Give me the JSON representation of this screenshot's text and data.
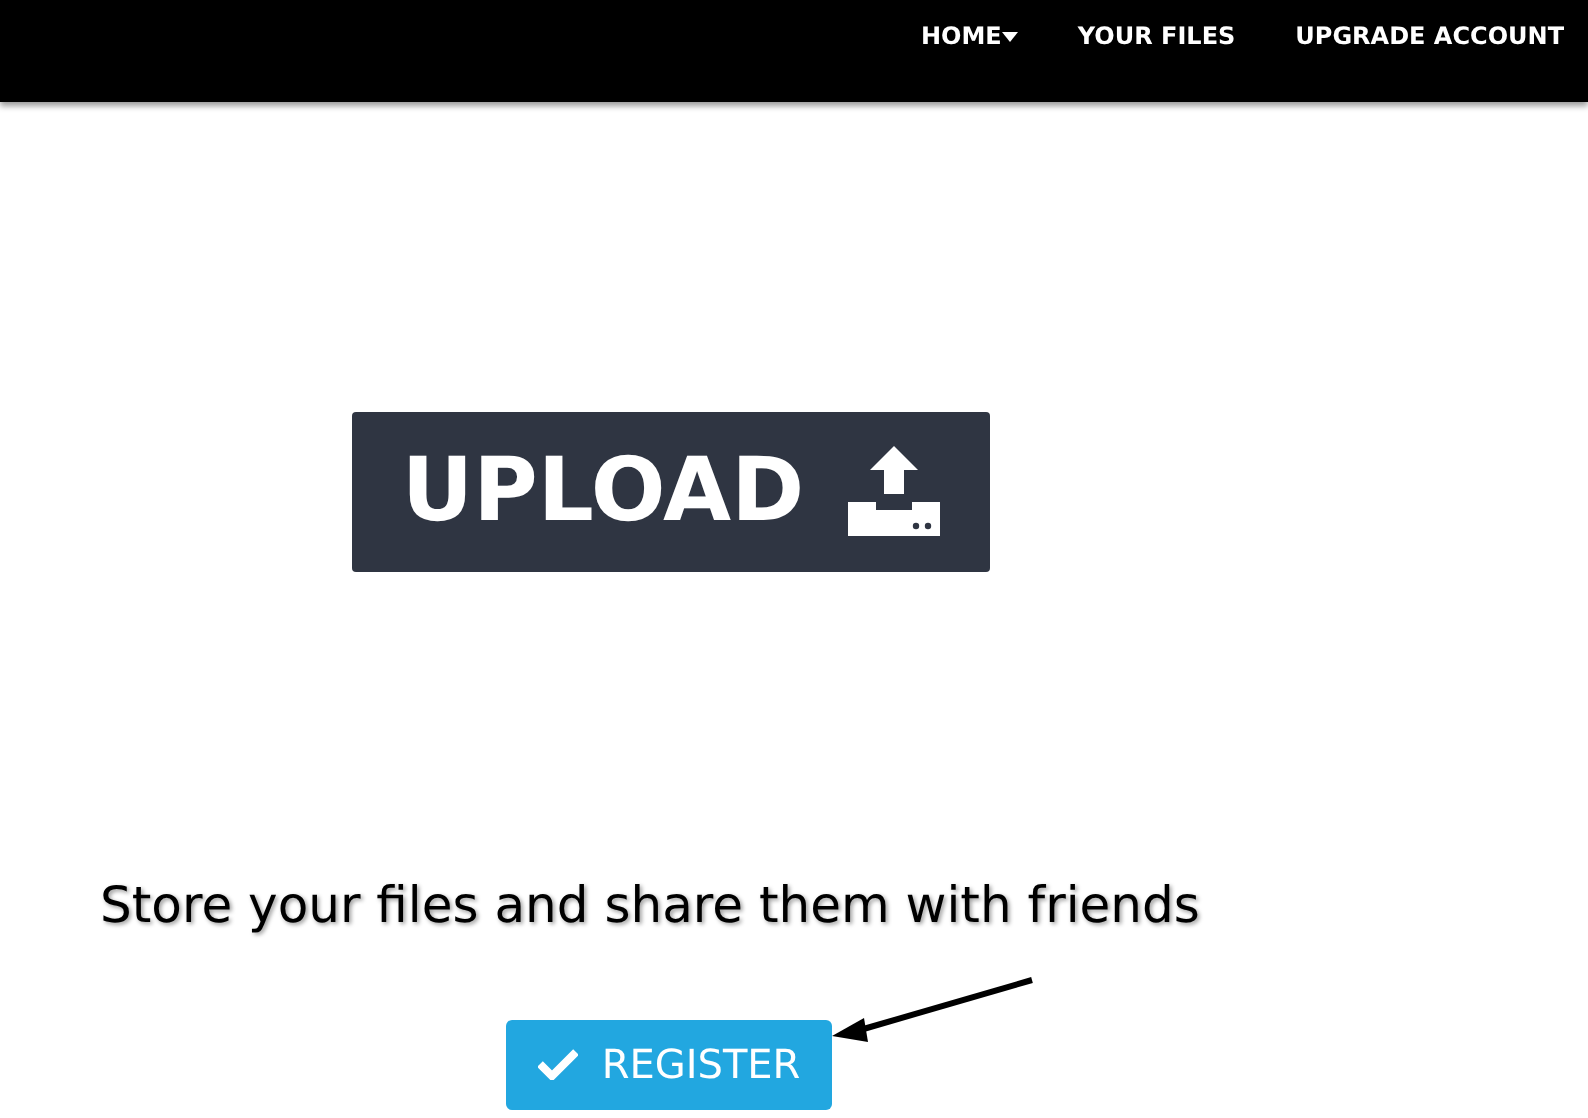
{
  "nav": {
    "items": [
      {
        "label": "HOME",
        "dropdown": true
      },
      {
        "label": "YOUR FILES",
        "dropdown": false
      },
      {
        "label": "UPGRADE ACCOUNT",
        "dropdown": false
      }
    ]
  },
  "upload_button": {
    "label": "UPLOAD"
  },
  "tagline": "Store your files and share them with friends",
  "register_button": {
    "label": "REGISTER"
  }
}
